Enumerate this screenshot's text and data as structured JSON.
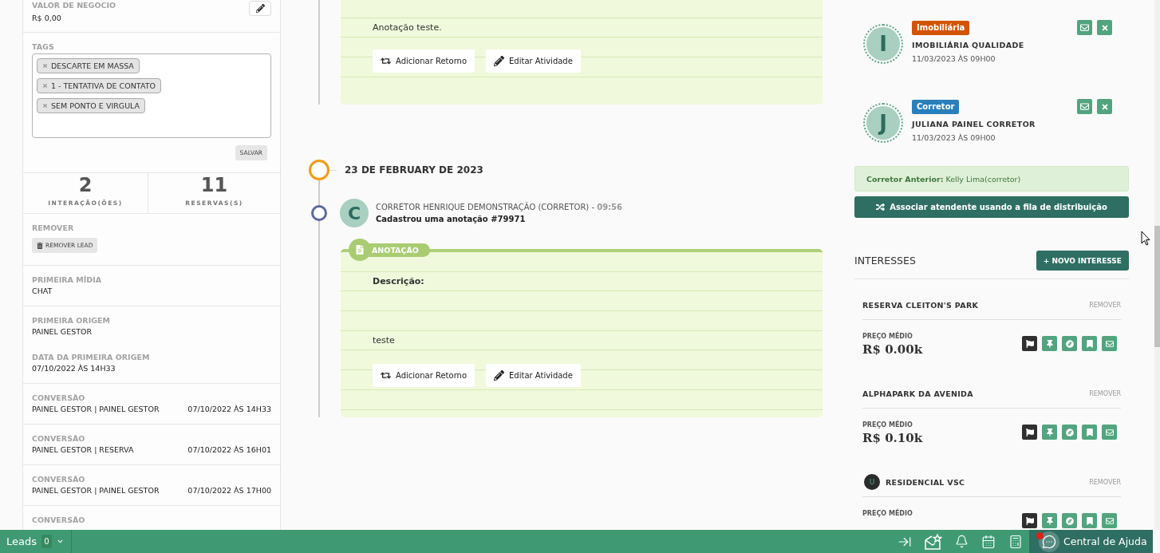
{
  "lead_panel": {
    "deal_value": {
      "label": "VALOR DE NEGOCIO",
      "value": "R$ 0,00"
    },
    "tags": {
      "label": "TAGS",
      "items": [
        "DESCARTE EM MASSA",
        "1 - TENTATIVA DE CONTATO",
        "SEM PONTO E VIRGULA"
      ],
      "save_button": "SALVAR"
    },
    "stats": [
      {
        "value": "2",
        "label": "INTERAÇÃO(ÕES)"
      },
      {
        "value": "11",
        "label": "RESERVAS(S)"
      }
    ],
    "remove": {
      "label": "REMOVER",
      "button": "REMOVER LEAD"
    },
    "info_groups": [
      {
        "fields": [
          {
            "label": "PRIMEIRA MÍDIA",
            "value": "CHAT"
          }
        ]
      },
      {
        "fields": [
          {
            "label": "PRIMEIRA ORIGEM",
            "value": "PAINEL GESTOR"
          },
          {
            "label": "DATA DA PRIMEIRA ORIGEM",
            "value": "07/10/2022 ÀS 14H33"
          }
        ]
      }
    ],
    "conversions": [
      {
        "label": "CONVERSÃO",
        "value": "PAINEL GESTOR | PAINEL GESTOR",
        "date": "07/10/2022 ÀS 14H33"
      },
      {
        "label": "CONVERSÃO",
        "value": "PAINEL GESTOR | RESERVA",
        "date": "07/10/2022 ÀS 16H01"
      },
      {
        "label": "CONVERSÃO",
        "value": "PAINEL GESTOR | PAINEL GESTOR",
        "date": "07/10/2022 ÀS 17H00"
      },
      {
        "label": "CONVERSÃO"
      }
    ]
  },
  "timeline": [
    {
      "kind": "card",
      "text": "Anotação teste.",
      "buttons": [
        {
          "kind": "return",
          "label": "Adicionar Retorno"
        },
        {
          "kind": "edit",
          "label": "Editar Atividade"
        }
      ]
    },
    {
      "kind": "date",
      "label": "23 DE FEBRUARY DE 2023"
    },
    {
      "kind": "event",
      "avatar": "C",
      "byline": "CORRETOR HENRIQUE DEMONSTRAÇÃO (CORRETOR) - **09:56**",
      "action": "Cadastrou uma anotação #79971"
    },
    {
      "kind": "card",
      "badge": "ANOTAÇÃO",
      "heading": "Descrição:",
      "text": "teste",
      "buttons": [
        {
          "kind": "return",
          "label": "Adicionar Retorno"
        },
        {
          "kind": "edit",
          "label": "Editar Atividade"
        }
      ]
    }
  ],
  "attendants": [
    {
      "role": "Imobiliária",
      "color": "#d35400",
      "initial": "I",
      "name": "IMOBILIÁRIA QUALIDADE",
      "date": "11/03/2023 ÀS 09H00"
    },
    {
      "role": "Corretor",
      "color": "#2a7fba",
      "initial": "J",
      "name": "JULIANA PAINEL CORRETOR",
      "date": "11/03/2023 ÀS 09H00"
    }
  ],
  "previous_broker": "**Corretor Anterior:** Kelly Lima(corretor)",
  "distribute_button": "Associar atendente usando a fila de distribuição",
  "interests": {
    "title": "INTERESSES",
    "new_button": "+ NOVO INTERESSE",
    "items": [
      {
        "name": "RESERVA CLEITON'S PARK",
        "remove": "REMOVER",
        "price_label": "PREÇO MÉDIO",
        "price": "R$ 0.00k",
        "flagged": true
      },
      {
        "name": "ALPHAPARK DA AVENIDA",
        "remove": "REMOVER",
        "price_label": "PREÇO MÉDIO",
        "price": "R$ 0.10k",
        "flagged": true
      },
      {
        "avatar": "U",
        "name": "RESIDENCIAL VSC",
        "remove": "REMOVER",
        "price_label": "PREÇO MÉDIO",
        "flagged": true
      }
    ]
  },
  "bottom_bar": {
    "module": "Leads",
    "count": "0",
    "help": "Central de Ajuda",
    "help_notification": true
  }
}
